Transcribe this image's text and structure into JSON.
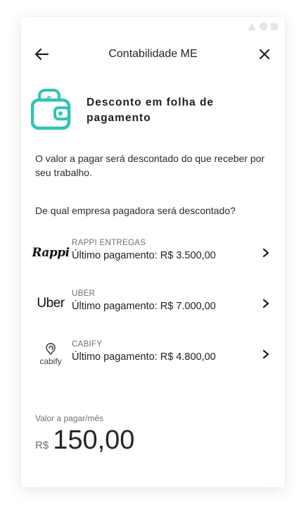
{
  "header": {
    "title": "Contabilidade ME",
    "back_icon": "arrow-left-icon",
    "close_icon": "close-icon"
  },
  "hero": {
    "icon": "wallet-icon",
    "title": "Desconto em folha de pagamento"
  },
  "description": "O valor a pagar será descontado do que receber por seu trabalho.",
  "question": "De qual empresa pagadora será descontado?",
  "companies": [
    {
      "logo_text": "Rappi",
      "name": "RAPPI ENTREGAS",
      "payment": "Último pagamento: R$ 3.500,00"
    },
    {
      "logo_text": "Uber",
      "name": "UBER",
      "payment": "Último pagamento: R$ 7.000,00"
    },
    {
      "logo_text": "cabify",
      "name": "CABIFY",
      "payment": "Último pagamento: R$ 4.800,00"
    }
  ],
  "price": {
    "label": "Valor a pagar/mês",
    "currency": "R$",
    "amount": "150,00"
  },
  "colors": {
    "accent": "#2ec4b6",
    "text": "#1f1f24",
    "muted": "#6e6e76"
  }
}
